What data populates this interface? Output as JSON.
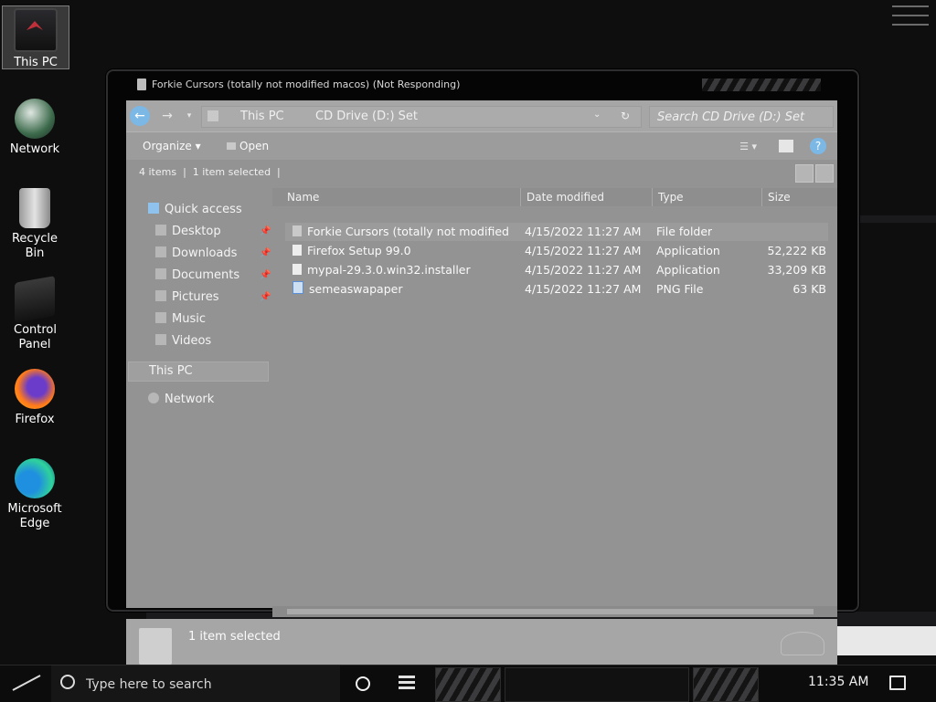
{
  "desktop": {
    "icons": [
      {
        "label": "This PC",
        "icon": "computer-icon"
      },
      {
        "label": "Network",
        "icon": "network-globe-icon"
      },
      {
        "label": "Recycle Bin",
        "icon": "recycle-bin-icon"
      },
      {
        "label": "Control Panel",
        "icon": "control-panel-icon"
      },
      {
        "label": "Firefox",
        "icon": "firefox-icon"
      },
      {
        "label": "Microsoft Edge",
        "icon": "edge-icon"
      }
    ]
  },
  "window": {
    "title": "Forkie Cursors (totally not modified macos) (Not Responding)",
    "address": {
      "crumbs": [
        "This PC",
        "CD Drive (D:) Set"
      ]
    },
    "search_placeholder": "Search CD Drive (D:) Set",
    "toolbar": {
      "organize": "Organize",
      "open": "Open"
    },
    "status_top": {
      "item_count": "4 items",
      "selected": "1 item selected"
    },
    "nav": {
      "quick_access": "Quick access",
      "pinned": [
        "Desktop",
        "Downloads",
        "Documents",
        "Pictures"
      ],
      "unpinned": [
        "Music",
        "Videos"
      ],
      "this_pc": "This PC",
      "network": "Network"
    },
    "columns": {
      "name": "Name",
      "date": "Date modified",
      "type": "Type",
      "size": "Size"
    },
    "files": [
      {
        "name": "Forkie Cursors (totally not modified ...",
        "date": "4/15/2022 11:27 AM",
        "type": "File folder",
        "size": "",
        "icon": "folder-icon"
      },
      {
        "name": "Firefox Setup 99.0",
        "date": "4/15/2022 11:27 AM",
        "type": "Application",
        "size": "52,222 KB",
        "icon": "application-icon"
      },
      {
        "name": "mypal-29.3.0.win32.installer",
        "date": "4/15/2022 11:27 AM",
        "type": "Application",
        "size": "33,209 KB",
        "icon": "application-icon"
      },
      {
        "name": "semeaswapaper",
        "date": "4/15/2022 11:27 AM",
        "type": "PNG File",
        "size": "63 KB",
        "icon": "png-file-icon"
      }
    ],
    "details_pane": "1 item selected"
  },
  "taskbar": {
    "search_placeholder": "Type here to search",
    "clock": "11:35 AM"
  }
}
